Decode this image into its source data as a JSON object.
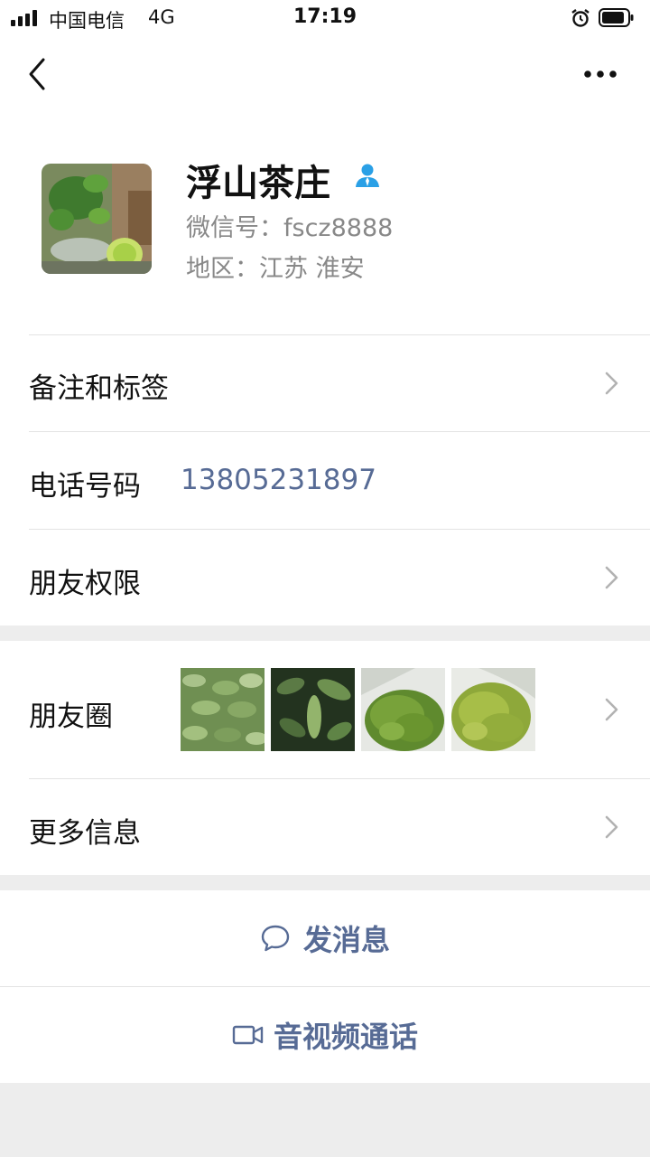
{
  "status_bar": {
    "carrier": "中国电信",
    "network": "4G",
    "time": "17:19"
  },
  "nav": {
    "back_icon": "chevron-left-icon",
    "more_icon": "ellipsis-icon"
  },
  "profile": {
    "name": "浮山茶庄",
    "wechat_id": "微信号：fscz8888",
    "region": "地区：江苏 淮安"
  },
  "rows": {
    "remark": "备注和标签",
    "phone_label": "电话号码",
    "phone_number": "13805231897",
    "permissions": "朋友权限",
    "moments": "朋友圈",
    "more_info": "更多信息"
  },
  "actions": {
    "message": "发消息",
    "call": "音视频通话"
  },
  "colors": {
    "link_blue": "#576b95",
    "page_gray": "#ededed",
    "verified_blue": "#2aa0e6"
  }
}
